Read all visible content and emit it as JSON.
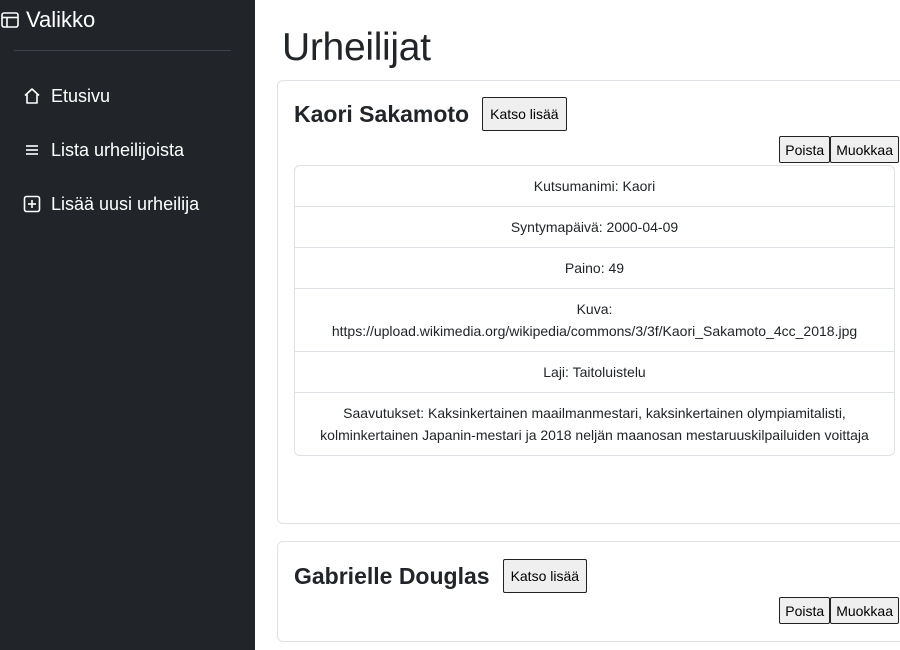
{
  "sidebar": {
    "brand": "Valikko",
    "brand_icon": "layout-window-icon",
    "items": [
      {
        "label": "Etusivu",
        "icon": "house-icon"
      },
      {
        "label": "Lista urheilijoista",
        "icon": "list-icon"
      },
      {
        "label": "Lisää uusi urheilija",
        "icon": "plus-square-icon"
      }
    ]
  },
  "page": {
    "title": "Urheilijat"
  },
  "athletes": [
    {
      "name": "Kaori Sakamoto",
      "more_label": "Katso lisää",
      "delete_label": "Poista",
      "edit_label": "Muokkaa",
      "nickname": "Kutsumanimi: Kaori",
      "birthdate": "Syntymapäivä: 2000-04-09",
      "weight": "Paino: 49",
      "image_label": "Kuva:",
      "image_url": "https://upload.wikimedia.org/wikipedia/commons/3/3f/Kaori_Sakamoto_4cc_2018.jpg",
      "sport": "Laji: Taitoluistelu",
      "achievements": "Saavutukset: Kaksinkertainen maailmanmestari, kaksinkertainen olympiamitalisti, kolminkertainen Japanin-mestari ja 2018 neljän maanosan mestaruuskilpailuiden voittaja"
    },
    {
      "name": "Gabrielle Douglas",
      "more_label": "Katso lisää",
      "delete_label": "Poista",
      "edit_label": "Muokkaa"
    }
  ],
  "colors": {
    "sidebar_bg": "#212529",
    "border": "#dee2e6",
    "text": "#212529"
  }
}
